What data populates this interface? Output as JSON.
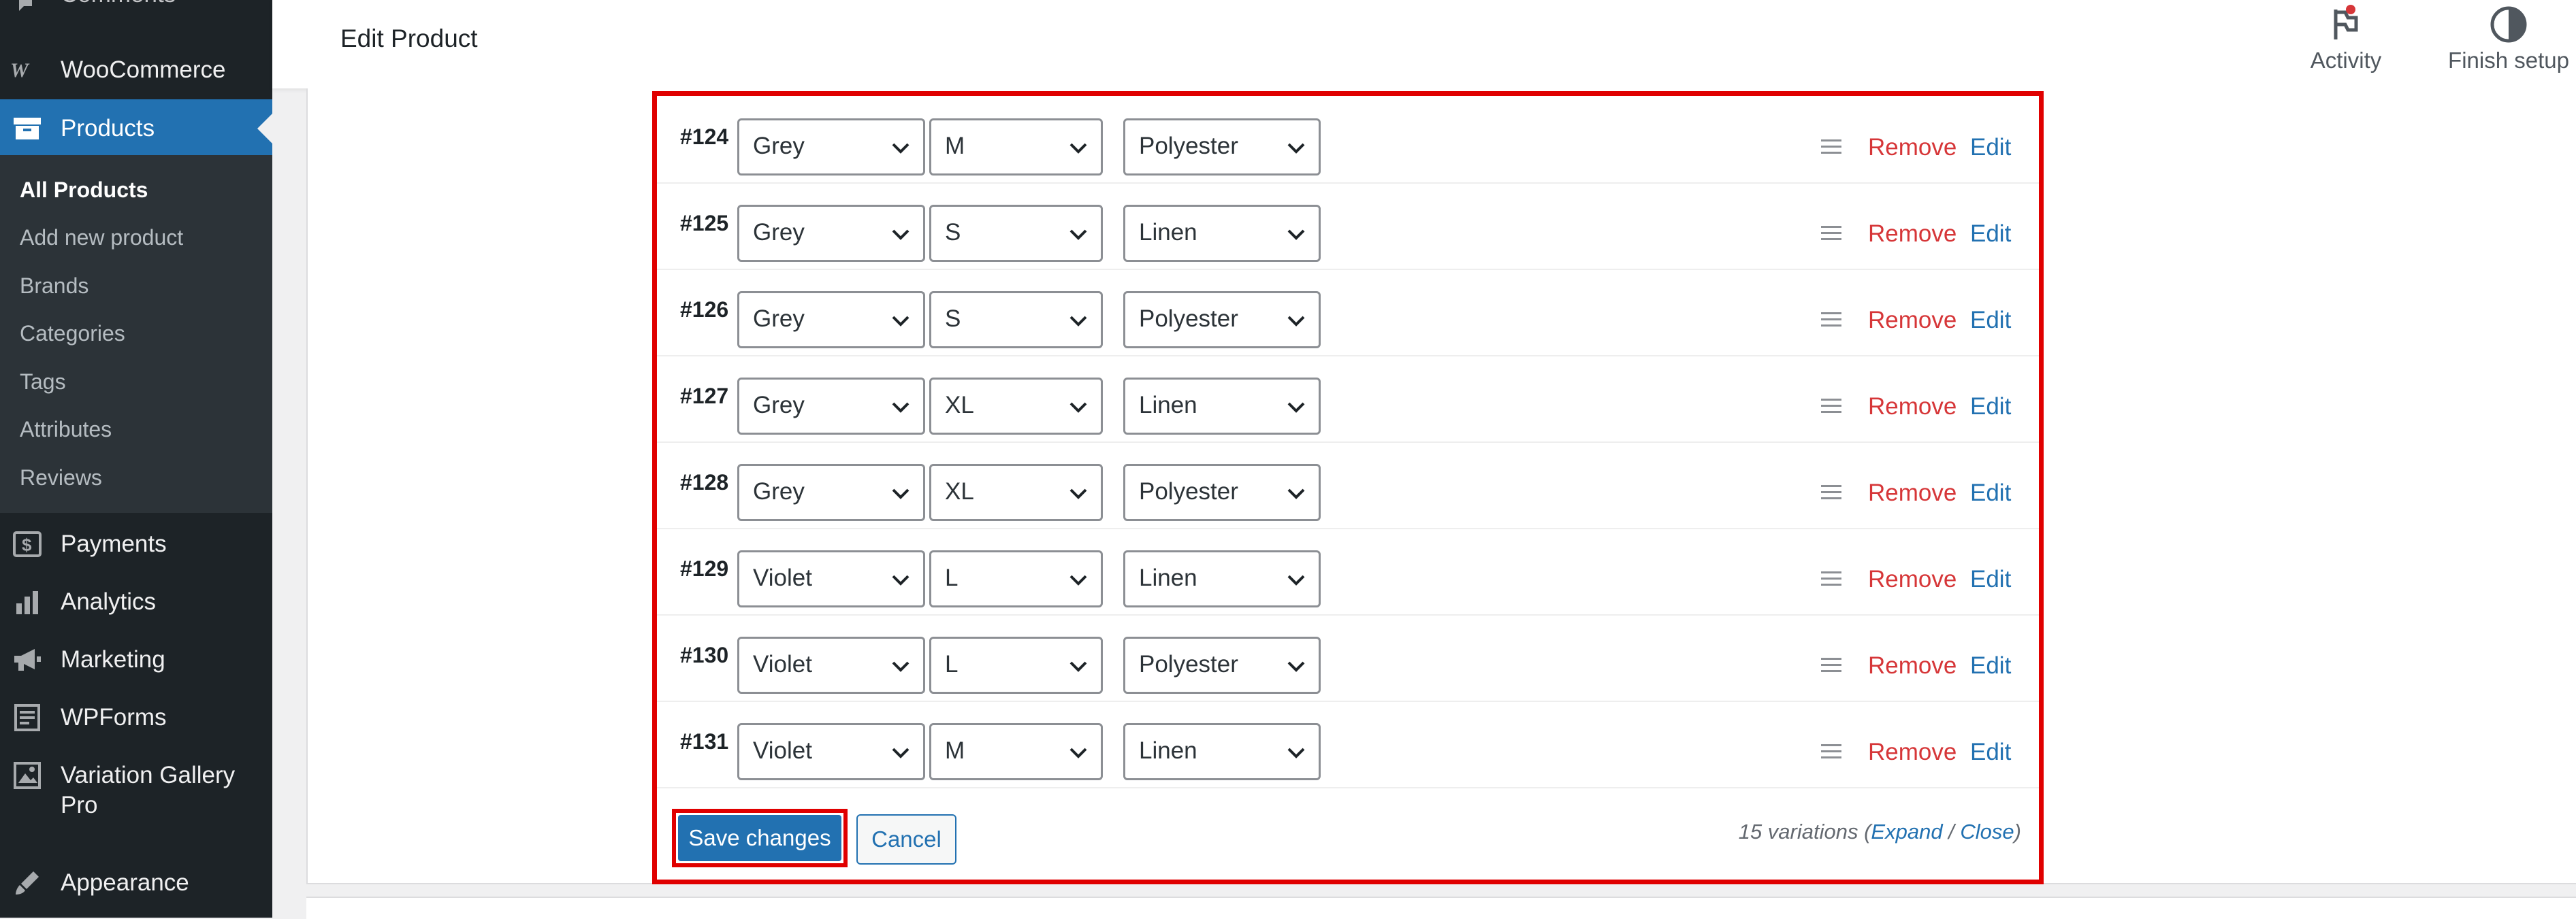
{
  "sidebar": {
    "top_item": {
      "label": "Comments",
      "icon": "comment-icon"
    },
    "woocommerce": {
      "label": "WooCommerce",
      "icon": "woo-icon"
    },
    "products": {
      "label": "Products",
      "icon": "archive-icon"
    },
    "submenu": [
      {
        "label": "All Products",
        "current": true
      },
      {
        "label": "Add new product"
      },
      {
        "label": "Brands"
      },
      {
        "label": "Categories"
      },
      {
        "label": "Tags"
      },
      {
        "label": "Attributes"
      },
      {
        "label": "Reviews"
      }
    ],
    "payments": {
      "label": "Payments",
      "icon": "dollar-icon"
    },
    "analytics": {
      "label": "Analytics",
      "icon": "chart-bar-icon"
    },
    "marketing": {
      "label": "Marketing",
      "icon": "megaphone-icon"
    },
    "wpforms": {
      "label": "WPForms",
      "icon": "form-icon"
    },
    "variation_gallery": {
      "label_line1": "Variation Gallery",
      "label_line2": "Pro",
      "icon": "gallery-icon"
    },
    "appearance": {
      "label": "Appearance",
      "icon": "brush-icon"
    }
  },
  "header": {
    "title": "Edit Product",
    "activity": {
      "label": "Activity",
      "icon": "flag-icon"
    },
    "finish_setup": {
      "label": "Finish setup",
      "icon": "half-circle-icon"
    }
  },
  "variations": {
    "rows": [
      {
        "id": "#124",
        "color": "Grey",
        "size": "M",
        "material": "Polyester"
      },
      {
        "id": "#125",
        "color": "Grey",
        "size": "S",
        "material": "Linen"
      },
      {
        "id": "#126",
        "color": "Grey",
        "size": "S",
        "material": "Polyester"
      },
      {
        "id": "#127",
        "color": "Grey",
        "size": "XL",
        "material": "Linen"
      },
      {
        "id": "#128",
        "color": "Grey",
        "size": "XL",
        "material": "Polyester"
      },
      {
        "id": "#129",
        "color": "Violet",
        "size": "L",
        "material": "Linen"
      },
      {
        "id": "#130",
        "color": "Violet",
        "size": "L",
        "material": "Polyester"
      },
      {
        "id": "#131",
        "color": "Violet",
        "size": "M",
        "material": "Linen"
      }
    ],
    "remove_label": "Remove",
    "edit_label": "Edit",
    "save_label": "Save changes",
    "cancel_label": "Cancel",
    "count_text": "15 variations (",
    "expand_label": "Expand",
    "separator": " / ",
    "close_label": "Close",
    "count_suffix": ")"
  },
  "colors": {
    "accent": "#2271b1",
    "highlight": "#e00000",
    "remove": "#d63638",
    "sidebar": "#1d2327"
  }
}
